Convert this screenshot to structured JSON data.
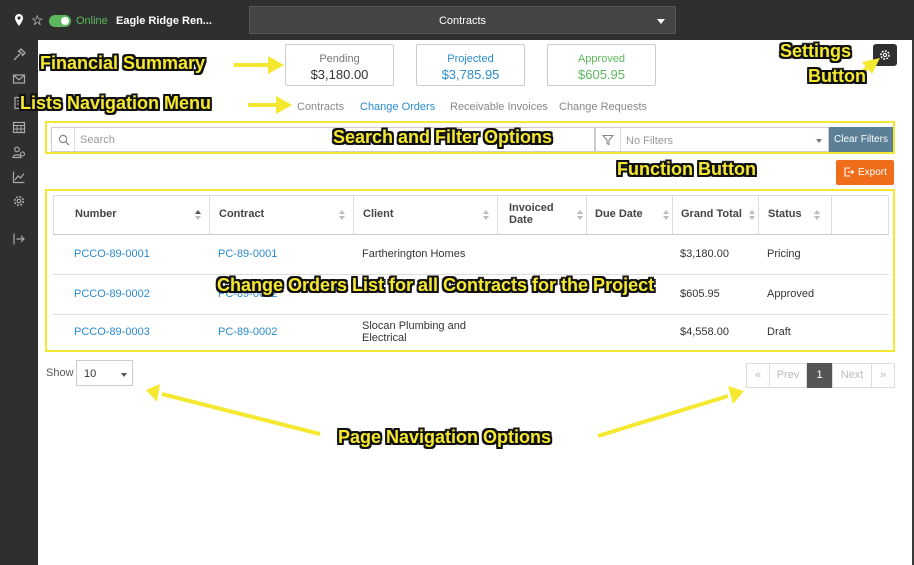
{
  "topbar": {
    "status": "Online",
    "project_name": "Eagle Ridge Ren...",
    "section_select": "Contracts"
  },
  "summary": {
    "pending_label": "Pending",
    "pending_value": "$3,180.00",
    "projected_label": "Projected",
    "projected_value": "$3,785.95",
    "approved_label": "Approved",
    "approved_value": "$605.95"
  },
  "tabs": [
    "Contracts",
    "Change Orders",
    "Receivable Invoices",
    "Change Requests"
  ],
  "search": {
    "placeholder": "Search"
  },
  "filter": {
    "label": "No Filters",
    "clear_label": "Clear Filters"
  },
  "export_label": "Export",
  "table": {
    "headers": [
      "Number",
      "Contract",
      "Client",
      "Invoiced Date",
      "Due Date",
      "Grand Total",
      "Status"
    ],
    "rows": [
      {
        "number": "PCCO-89-0001",
        "contract": "PC-89-0001",
        "client": "Fartherington Homes",
        "invoiced_date": "",
        "due_date": "",
        "grand_total": "$3,180.00",
        "status": "Pricing"
      },
      {
        "number": "PCCO-89-0002",
        "contract": "PC-89-0002",
        "client": "",
        "invoiced_date": "",
        "due_date": "",
        "grand_total": "$605.95",
        "status": "Approved"
      },
      {
        "number": "PCCO-89-0003",
        "contract": "PC-89-0002",
        "client": "Slocan Plumbing and Electrical",
        "invoiced_date": "",
        "due_date": "",
        "grand_total": "$4,558.00",
        "status": "Draft"
      }
    ]
  },
  "paging": {
    "show_label": "Show",
    "page_size": "10",
    "first": "«",
    "prev": "Prev",
    "current": "1",
    "next": "Next",
    "last": "»"
  },
  "annotations": {
    "financial_summary": "Financial Summary",
    "settings_line1": "Settings",
    "settings_line2": "Button",
    "lists_nav": "Lists Navigation Menu",
    "search_filter": "Search and Filter Options",
    "function_button": "Function Button",
    "change_orders_list": "Change Orders List for all Contracts for the Project",
    "page_nav": "Page Navigation Options"
  },
  "colors": {
    "annotation": "#f5e830",
    "link": "#2a8bd0",
    "approved": "#5cb85c",
    "export": "#ef6c1a",
    "clear_filters": "#5b7f96",
    "chrome": "#2f2f2f"
  }
}
